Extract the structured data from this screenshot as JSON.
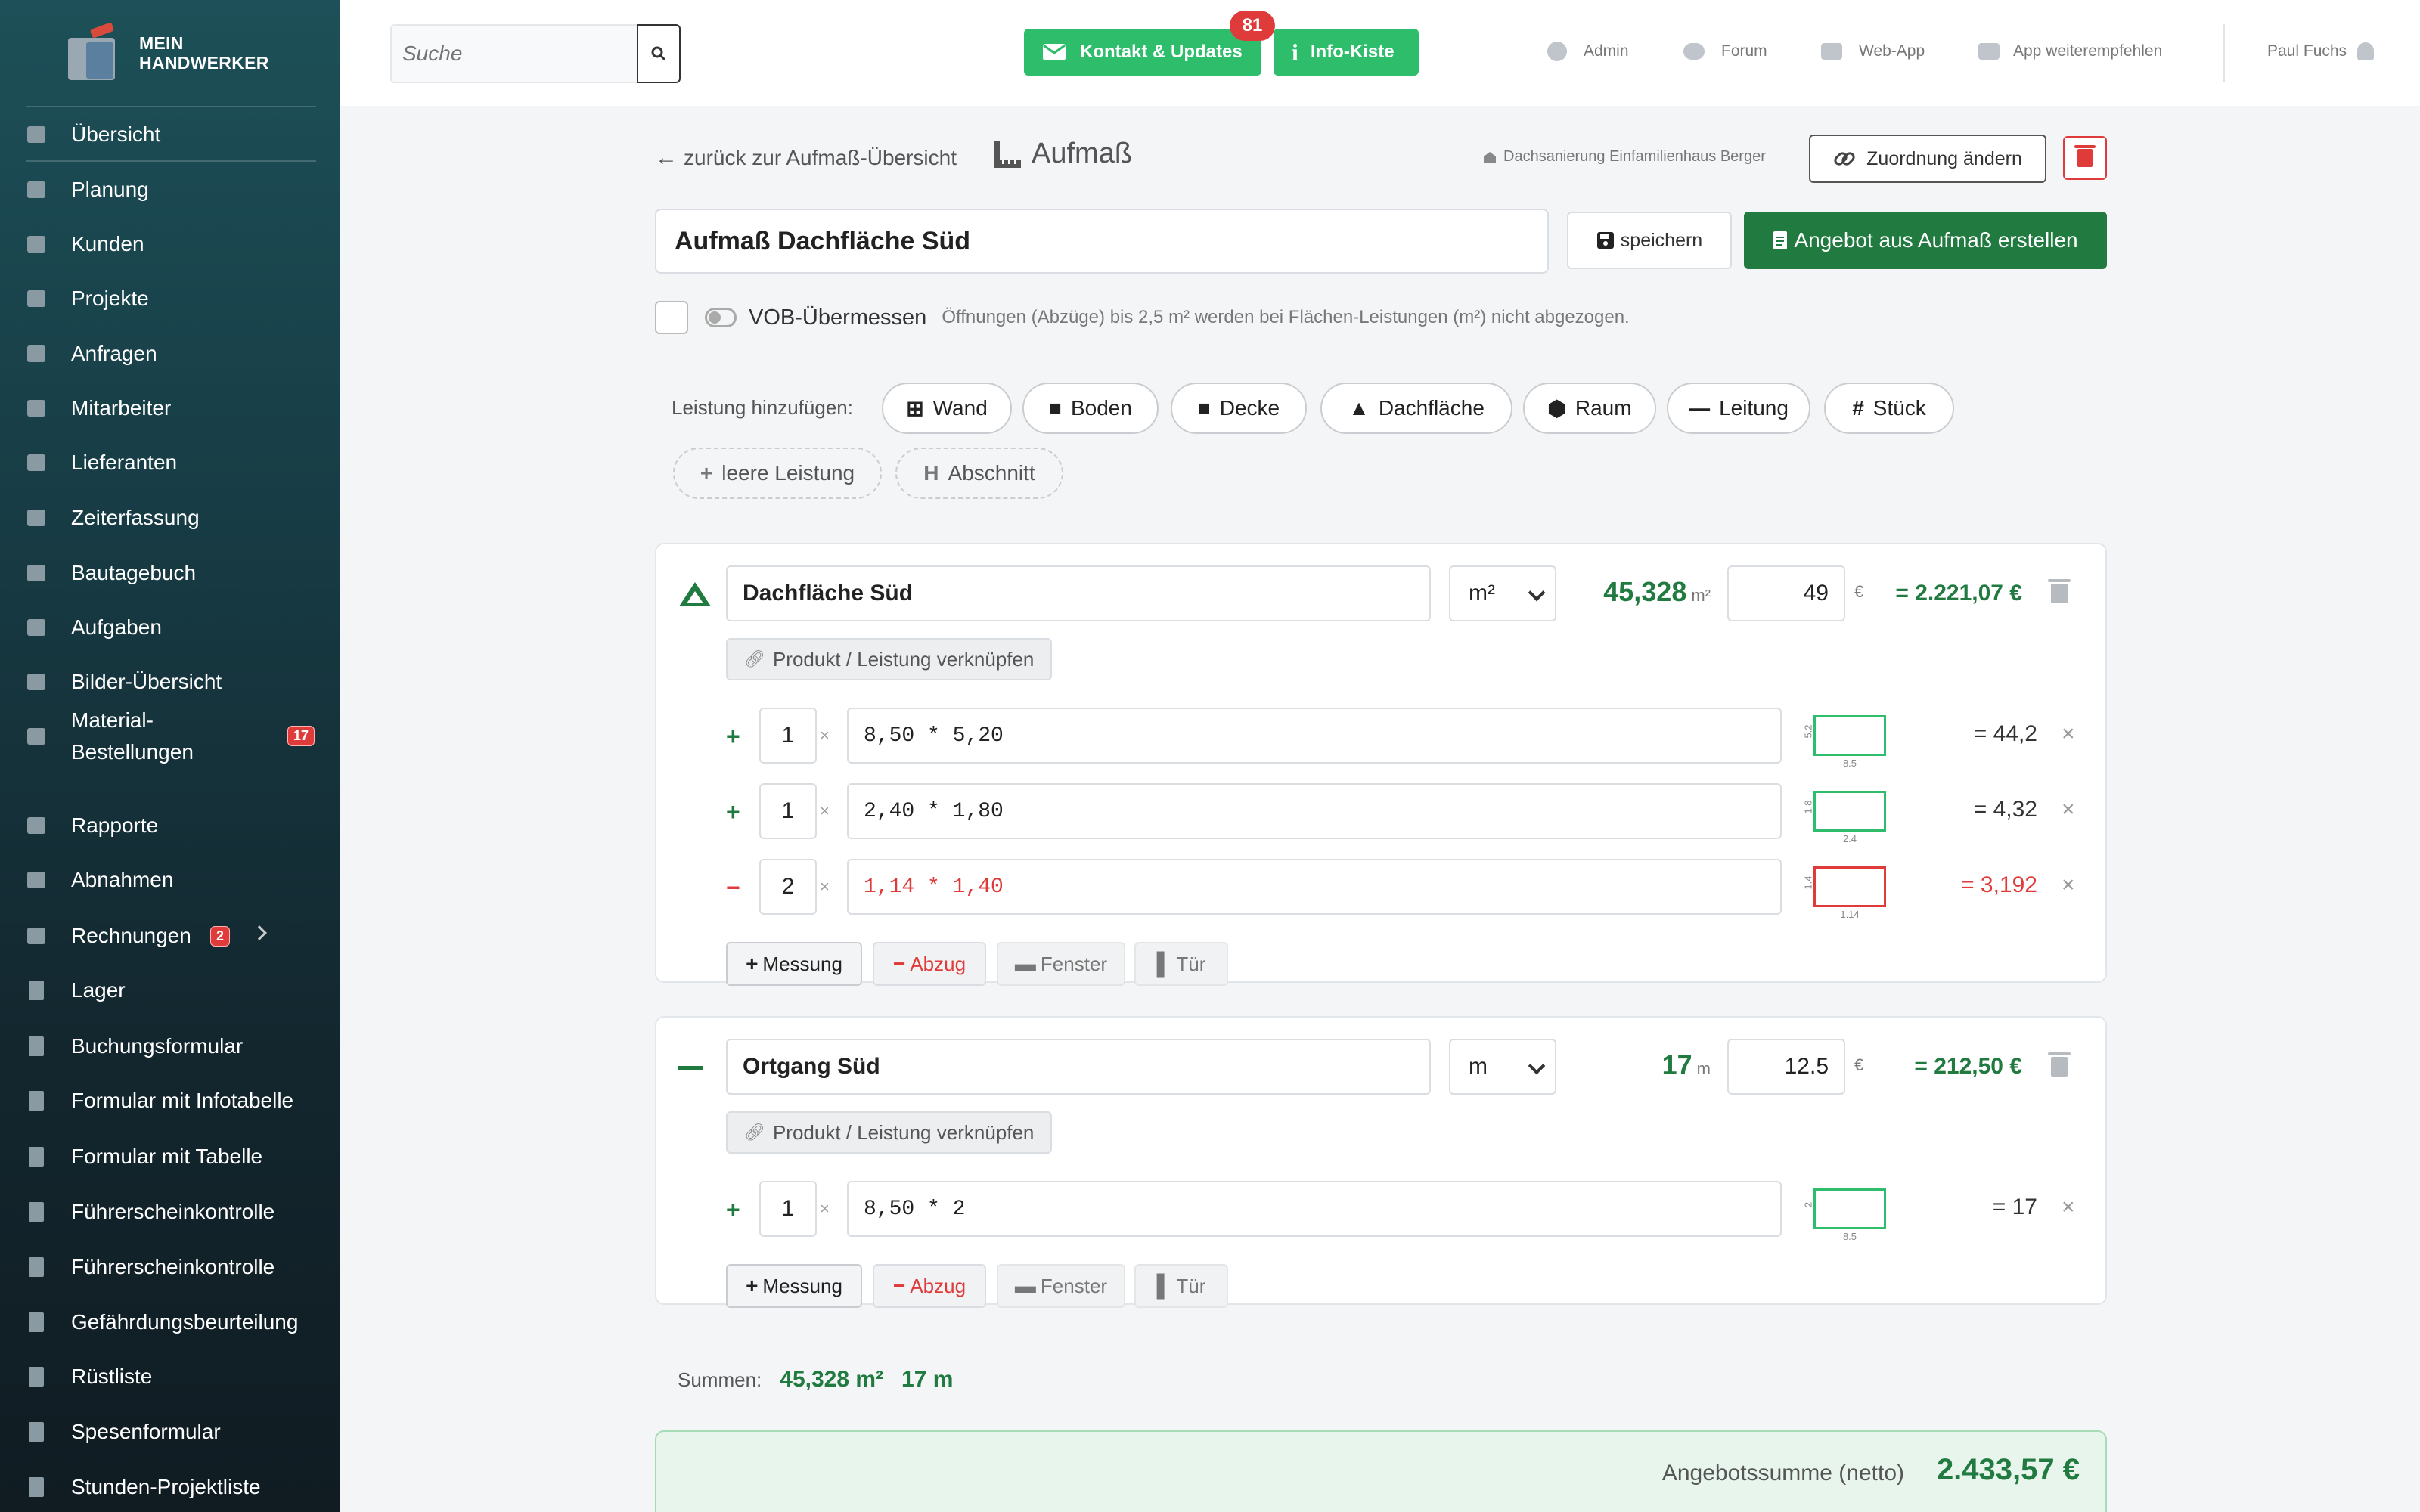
{
  "brand": {
    "line1": "MEIN",
    "line2": "HANDWERKER"
  },
  "sidebar": {
    "items": [
      {
        "label": "Übersicht"
      },
      {
        "label": "Planung"
      },
      {
        "label": "Kunden"
      },
      {
        "label": "Projekte"
      },
      {
        "label": "Anfragen"
      },
      {
        "label": "Mitarbeiter"
      },
      {
        "label": "Lieferanten"
      },
      {
        "label": "Zeiterfassung"
      },
      {
        "label": "Bautagebuch"
      },
      {
        "label": "Aufgaben"
      },
      {
        "label": "Bilder-Übersicht"
      },
      {
        "label": "Material-",
        "label2": "Bestellungen",
        "badge": "17"
      },
      {
        "label": "Rapporte"
      },
      {
        "label": "Abnahmen"
      },
      {
        "label": "Rechnungen",
        "badge": "2"
      },
      {
        "label": "Lager"
      },
      {
        "label": "Buchungsformular"
      },
      {
        "label": "Formular mit Infotabelle"
      },
      {
        "label": "Formular mit Tabelle"
      },
      {
        "label": "Führerscheinkontrolle"
      },
      {
        "label": "Führerscheinkontrolle"
      },
      {
        "label": "Gefährdungsbeurteilung"
      },
      {
        "label": "Rüstliste"
      },
      {
        "label": "Spesenformular"
      },
      {
        "label": "Stunden-Projektliste"
      }
    ]
  },
  "topbar": {
    "search_placeholder": "Suche",
    "contact_label": "Kontakt & Updates",
    "contact_badge": "81",
    "info_label": "Info-Kiste",
    "links": [
      {
        "label": "Admin"
      },
      {
        "label": "Forum"
      },
      {
        "label": "Web-App"
      },
      {
        "label": "App weiterempfehlen"
      }
    ],
    "user": "Paul Fuchs"
  },
  "header": {
    "back": "zurück zur Aufmaß-Übersicht",
    "title": "Aufmaß",
    "project": "Dachsanierung Einfamilienhaus Berger",
    "change_assignment": "Zuordnung ändern",
    "measurement_name": "Aufmaß Dachfläche Süd",
    "save": "speichern",
    "create_offer": "Angebot aus Aufmaß erstellen"
  },
  "vob": {
    "label": "VOB-Übermessen",
    "hint": "Öffnungen (Abzüge) bis 2,5 m² werden bei Flächen-Leistungen (m²) nicht abgezogen."
  },
  "add": {
    "label": "Leistung hinzufügen:",
    "buttons": [
      {
        "icon": "⊞",
        "label": "Wand"
      },
      {
        "icon": "■",
        "label": "Boden"
      },
      {
        "icon": "■",
        "label": "Decke"
      },
      {
        "icon": "▲",
        "label": "Dachfläche"
      },
      {
        "icon": "⬢",
        "label": "Raum"
      },
      {
        "icon": "—",
        "label": "Leitung"
      },
      {
        "icon": "#",
        "label": "Stück"
      }
    ],
    "extra": [
      {
        "icon": "+",
        "label": "leere Leistung"
      },
      {
        "icon": "H",
        "label": "Abschnitt"
      }
    ]
  },
  "positions": [
    {
      "icon": "roof-icon",
      "name": "Dachfläche Süd",
      "unit": "m²",
      "qty": "45,328",
      "qty_unit": "m²",
      "price": "49",
      "currency": "€",
      "total": "= 2.221,07 €",
      "link": "Produkt / Leistung verknüpfen",
      "rows": [
        {
          "sign": "+",
          "count": "1",
          "formula": "8,50 * 5,20",
          "h": "5.2",
          "w": "8.5",
          "result": "= 44,2",
          "negative": false
        },
        {
          "sign": "+",
          "count": "1",
          "formula": "2,40 * 1,80",
          "h": "1.8",
          "w": "2.4",
          "result": "= 4,32",
          "negative": false
        },
        {
          "sign": "−",
          "count": "2",
          "formula": "1,14 * 1,40",
          "h": "1.4",
          "w": "1.14",
          "result": "= 3,192",
          "negative": true
        }
      ]
    },
    {
      "icon": "line-icon",
      "name": "Ortgang Süd",
      "unit": "m",
      "qty": "17",
      "qty_unit": "m",
      "price": "12.5",
      "currency": "€",
      "total": "= 212,50 €",
      "link": "Produkt / Leistung verknüpfen",
      "rows": [
        {
          "sign": "+",
          "count": "1",
          "formula": "8,50 * 2",
          "h": "2",
          "w": "8.5",
          "result": "= 17",
          "negative": false
        }
      ]
    }
  ],
  "actions": {
    "measure": "Messung",
    "deduct": "Abzug",
    "window": "Fenster",
    "door": "Tür"
  },
  "sums": {
    "label": "Summen:",
    "m2": "45,328 m²",
    "m": "17 m"
  },
  "offer": {
    "label": "Angebotssumme (netto)",
    "value": "2.433,57 €"
  },
  "colors": {
    "green": "#217a3f",
    "accent": "#2ebd6b",
    "red": "#e03b3b"
  }
}
